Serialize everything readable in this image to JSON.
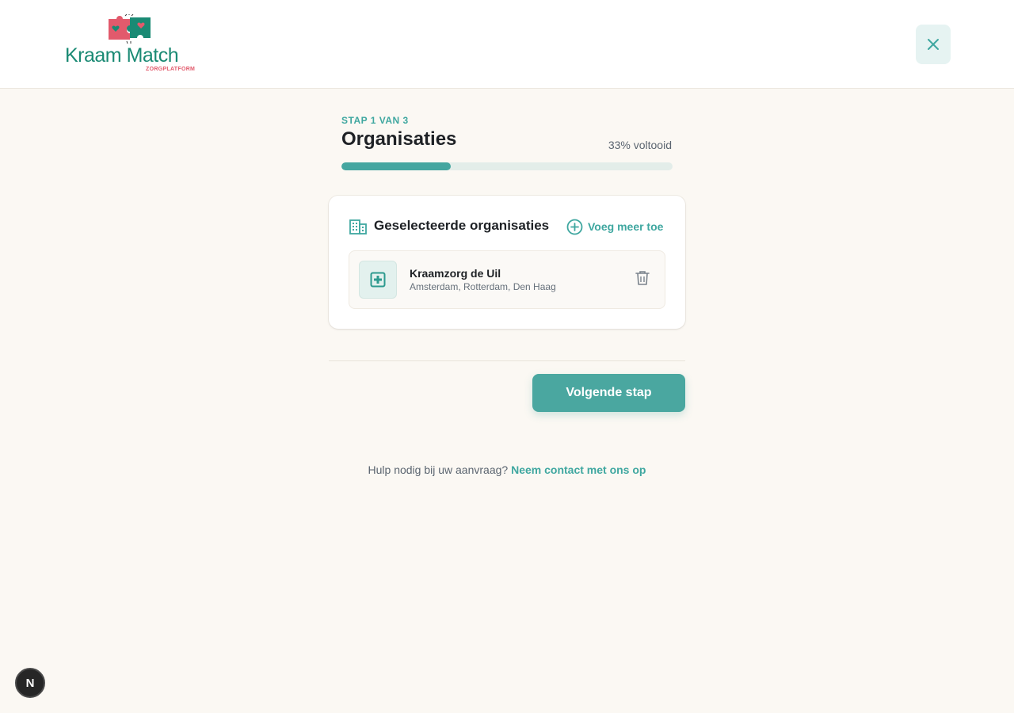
{
  "brand": {
    "name": "Kraam Match",
    "tagline": "ZORGPLATFORM",
    "primary_color": "#1a8a74",
    "accent_color": "#e25a6c"
  },
  "header": {
    "close_icon": "close-icon"
  },
  "step": {
    "label": "STAP 1 VAN 3",
    "title": "Organisaties",
    "progress_text": "33% voltooid",
    "progress_value": 0.33
  },
  "card": {
    "icon": "building-icon",
    "title": "Geselecteerde organisaties",
    "add_more_label": "Voeg meer toe",
    "organizations": [
      {
        "icon": "medical-plus-icon",
        "name": "Kraamzorg de Uil",
        "locations": "Amsterdam, Rotterdam, Den Haag",
        "delete_icon": "trash-icon"
      }
    ]
  },
  "actions": {
    "next_label": "Volgende stap"
  },
  "help": {
    "text": "Hulp nodig bij uw aanvraag?",
    "link": "Neem contact met ons op"
  },
  "dev_badge": {
    "label": "N"
  }
}
